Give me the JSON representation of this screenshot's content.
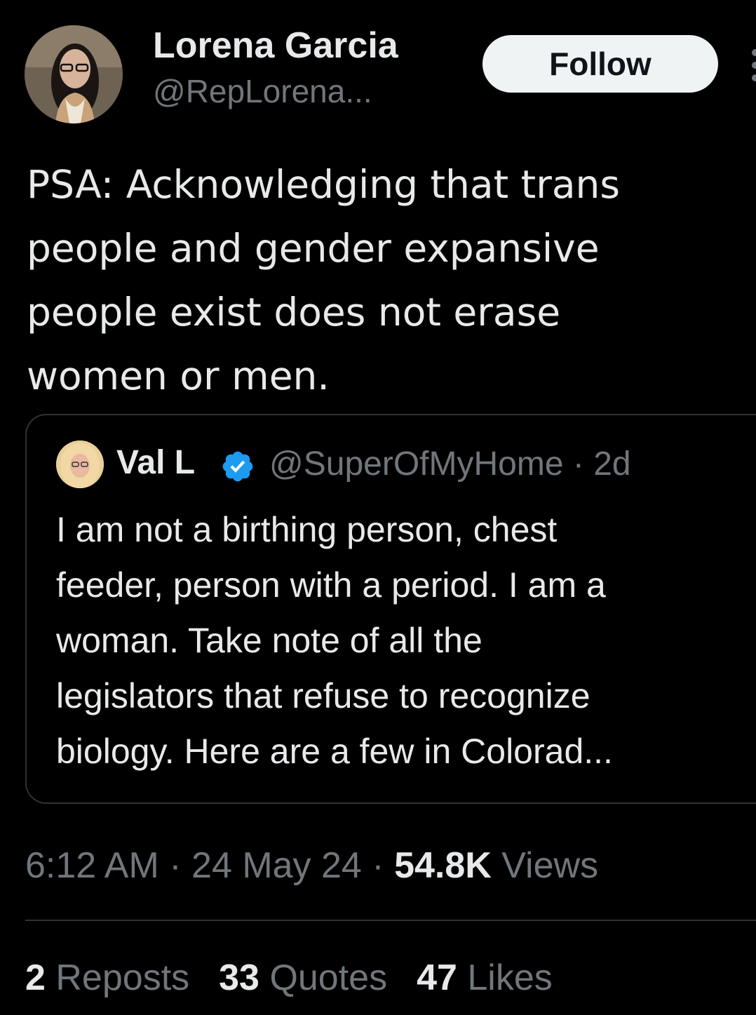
{
  "tweet": {
    "author": {
      "name": "Lorena Garcia",
      "handle": "@RepLorena..."
    },
    "follow_label": "Follow",
    "text_lines": [
      "PSA: Acknowledging that trans",
      "people and gender expansive",
      "people exist does not erase",
      "women or men."
    ],
    "quoted": {
      "name": "Val L",
      "handle": "@SuperOfMyHome",
      "separator": "·",
      "age": "2d",
      "text_lines": [
        "I am not a birthing person, chest",
        "feeder, person with a period.  I am a",
        "woman.  Take note of all the",
        "legislators that refuse to recognize",
        "biology.  Here are a few in Colorad..."
      ]
    },
    "time": "6:12 AM",
    "date": "24 May 24",
    "separator": "·",
    "views_count": "54.8K",
    "views_label": "Views",
    "stats": {
      "reposts_count": "2",
      "reposts_label": "Reposts",
      "quotes_count": "33",
      "quotes_label": "Quotes",
      "likes_count": "47",
      "likes_label": "Likes"
    }
  },
  "colors": {
    "background": "#000000",
    "primary_text": "#e7e9ea",
    "secondary_text": "#71767b",
    "verified_blue": "#1d9bf0",
    "follow_button_bg": "#eff3f4",
    "border": "#2f3336"
  },
  "icons": {
    "more": "more-icon",
    "verified": "verified-badge-icon"
  }
}
